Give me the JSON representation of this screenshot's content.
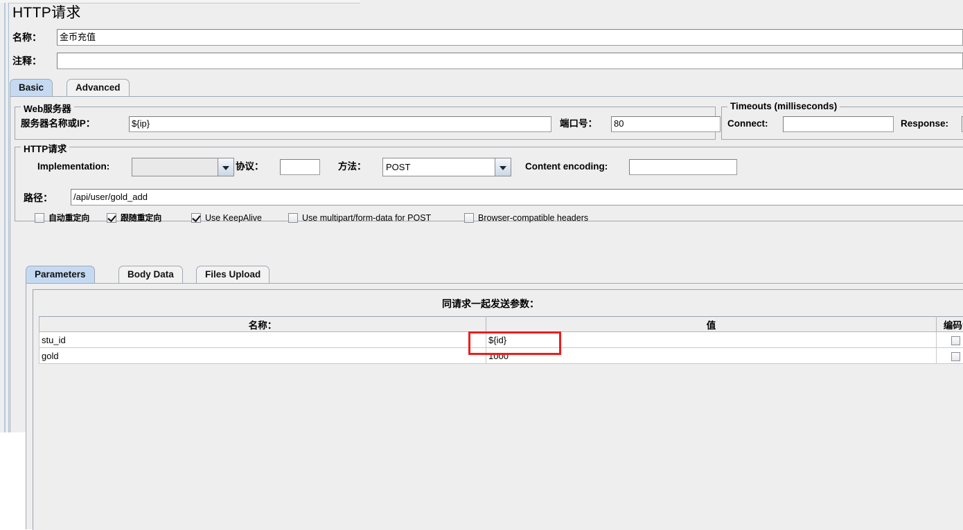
{
  "window": {
    "title": "HTTP请求"
  },
  "header": {
    "name_label": "名称：",
    "name_value": "金币充值",
    "comment_label": "注释：",
    "comment_value": "",
    "comment_placeholder": ""
  },
  "main_tabs": [
    {
      "label": "Basic",
      "active": true
    },
    {
      "label": "Advanced",
      "active": false
    }
  ],
  "web_server": {
    "group_title": "Web服务器",
    "server_label": "服务器名称或IP：",
    "server_value": "${ip}",
    "port_label": "端口号：",
    "port_value": "80"
  },
  "timeouts": {
    "group_title": "Timeouts (milliseconds)",
    "connect_label": "Connect:",
    "connect_value": "",
    "response_label": "Response:",
    "response_value": ""
  },
  "http_request": {
    "group_title": "HTTP请求",
    "implementation_label": "Implementation:",
    "implementation_value": "",
    "protocol_label": "协议：",
    "protocol_value": "",
    "method_label": "方法：",
    "method_value": "POST",
    "content_encoding_label": "Content encoding:",
    "content_encoding_value": "",
    "path_label": "路径：",
    "path_value": "/api/user/gold_add",
    "options": [
      {
        "label": "自动重定向",
        "checked": false,
        "cjk": true
      },
      {
        "label": "跟随重定向",
        "checked": true,
        "cjk": true
      },
      {
        "label": "Use KeepAlive",
        "checked": true,
        "cjk": false
      },
      {
        "label": "Use multipart/form-data for POST",
        "checked": false,
        "cjk": false
      },
      {
        "label": "Browser-compatible headers",
        "checked": false,
        "cjk": false
      }
    ]
  },
  "param_tabs": [
    {
      "label": "Parameters",
      "active": true
    },
    {
      "label": "Body Data",
      "active": false
    },
    {
      "label": "Files Upload",
      "active": false
    }
  ],
  "parameters": {
    "caption": "同请求一起发送参数：",
    "columns": [
      "名称：",
      "值",
      "编码?"
    ],
    "rows": [
      {
        "name": "stu_id",
        "value": "${id}",
        "encode": false
      },
      {
        "name": "gold",
        "value": "1000",
        "encode": false
      }
    ]
  },
  "annotation": {
    "highlight_color": "#ee1c1c",
    "highlight_target": "${id}"
  },
  "icons": {
    "combo_arrow": "chevron-down-icon",
    "checkbox_check": "check-icon"
  }
}
